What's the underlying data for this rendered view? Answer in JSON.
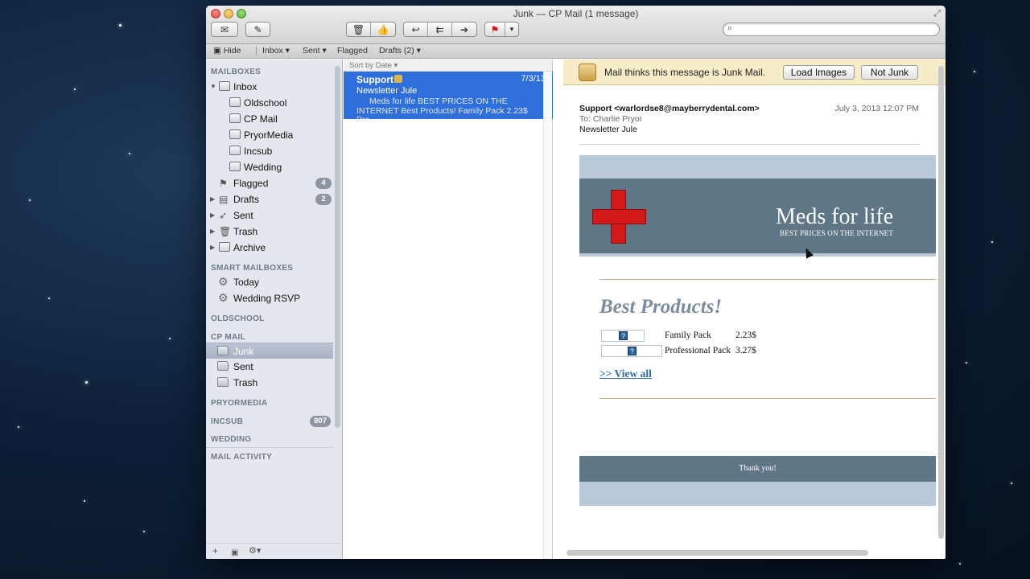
{
  "window": {
    "title": "Junk — CP Mail (1 message)"
  },
  "toolbar": {
    "get_mail_icon": "envelope-icon",
    "compose_icon": "compose-icon",
    "delete_icon": "trash-icon",
    "junk_icon": "thumbs-up-icon",
    "reply_icon": "reply-icon",
    "reply_all_icon": "reply-all-icon",
    "forward_icon": "forward-icon",
    "flag_icon": "flag-icon",
    "search_placeholder": ""
  },
  "favorites": {
    "hide": "Hide",
    "inbox": "Inbox",
    "sent": "Sent",
    "flagged": "Flagged",
    "drafts": "Drafts (2)"
  },
  "sidebar": {
    "mailboxes_header": "MAILBOXES",
    "inbox": "Inbox",
    "inbox_children": [
      "Oldschool",
      "CP Mail",
      "PryorMedia",
      "Incsub",
      "Wedding"
    ],
    "flagged": "Flagged",
    "flagged_count": "4",
    "drafts": "Drafts",
    "drafts_count": "2",
    "sent": "Sent",
    "trash": "Trash",
    "archive": "Archive",
    "smart_header": "SMART MAILBOXES",
    "today": "Today",
    "wedding_rsvp": "Wedding RSVP",
    "oldschool_header": "OLDSCHOOL",
    "cpmail_header": "CP MAIL",
    "cpmail_junk": "Junk",
    "cpmail_sent": "Sent",
    "cpmail_trash": "Trash",
    "pryormedia_header": "PRYORMEDIA",
    "incsub_header": "INCSUB",
    "incsub_count": "807",
    "wedding_header": "WEDDING",
    "activity_header": "MAIL ACTIVITY",
    "add": "+",
    "gear": "⚙▾"
  },
  "message_list": {
    "sort_label": "Sort by Date ▾",
    "messages": [
      {
        "from": "Support",
        "date": "7/3/13",
        "subject": "Newsletter Jule",
        "preview": "Meds for life BEST PRICES ON THE INTERNET Best Products! Family Pack 2.23$ Pro…"
      }
    ]
  },
  "viewer": {
    "junk_notice": "Mail thinks this message is Junk Mail.",
    "load_images": "Load Images",
    "not_junk": "Not Junk",
    "from": "Support <warlordse8@mayberrydental.com>",
    "date": "July 3, 2013  12:07 PM",
    "to": "To:  Charlie Pryor",
    "subject": "Newsletter Jule"
  },
  "email_body": {
    "title": "Meds for life",
    "tagline": "BEST PRICES ON THE INTERNET",
    "heading": "Best Products!",
    "products": [
      {
        "name": "Family Pack",
        "price": "2.23$"
      },
      {
        "name": "Professional Pack",
        "price": "3.27$"
      }
    ],
    "view_all": ">> View all",
    "footer": "Thank you!",
    "image_placeholder": "?"
  },
  "colors": {
    "selection": "#2f6fdb",
    "banner": "#5f7686",
    "cross": "#d31919",
    "junk_bar": "#f6ecc8"
  }
}
